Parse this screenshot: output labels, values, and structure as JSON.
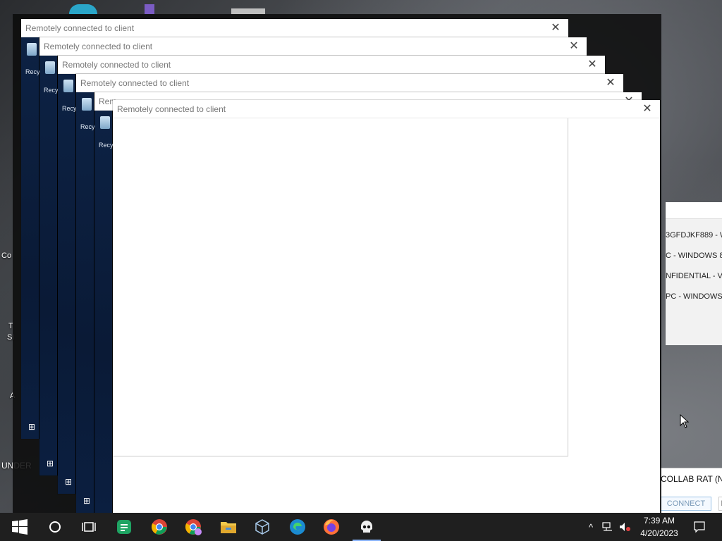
{
  "desktop": {
    "left_labels": [
      "Co",
      "T",
      "Si",
      "A",
      "UNDER"
    ],
    "top_icons": [
      "edge-icon",
      "folder-icon",
      "app-icon"
    ]
  },
  "windows": [
    {
      "title": "Remotely connected to client",
      "bin_label": "Recy",
      "close": "✕"
    },
    {
      "title": "Remotely connected to client",
      "bin_label": "Recy",
      "close": "✕"
    },
    {
      "title": "Remotely connected to client",
      "bin_label": "Recy",
      "close": "✕"
    },
    {
      "title": "Remotely connected to client",
      "bin_label": "Recy",
      "close": "✕"
    },
    {
      "title": "Rem",
      "bin_label": "Recy",
      "close": "✕"
    },
    {
      "title": "Remotely connected to client",
      "close": "✕"
    }
  ],
  "right_panel": {
    "rows": [
      "3GFDJKF889 - W",
      "C - WINDOWS 8",
      "NFIDENTIAL - V",
      "PC - WINDOWS"
    ]
  },
  "collab": {
    "title": "COLLAB RAT (N",
    "connect_label": "CONNECT",
    "second_label": "D"
  },
  "taskbar": {
    "start_icon": "windows-start-icon",
    "apps": [
      "search-circle-icon",
      "task-view-icon",
      "sheets-icon",
      "chrome-icon",
      "chrome-profile-icon",
      "file-explorer-icon",
      "cube-app-icon",
      "edge-icon",
      "firefox-icon",
      "skull-app-icon"
    ],
    "time": "7:39 AM",
    "date": "4/20/2023"
  },
  "colors": {
    "taskbar": "#1f1f1f",
    "window_bg": "#ffffff",
    "title_text": "#777777",
    "accent": "#8ab4f8"
  }
}
